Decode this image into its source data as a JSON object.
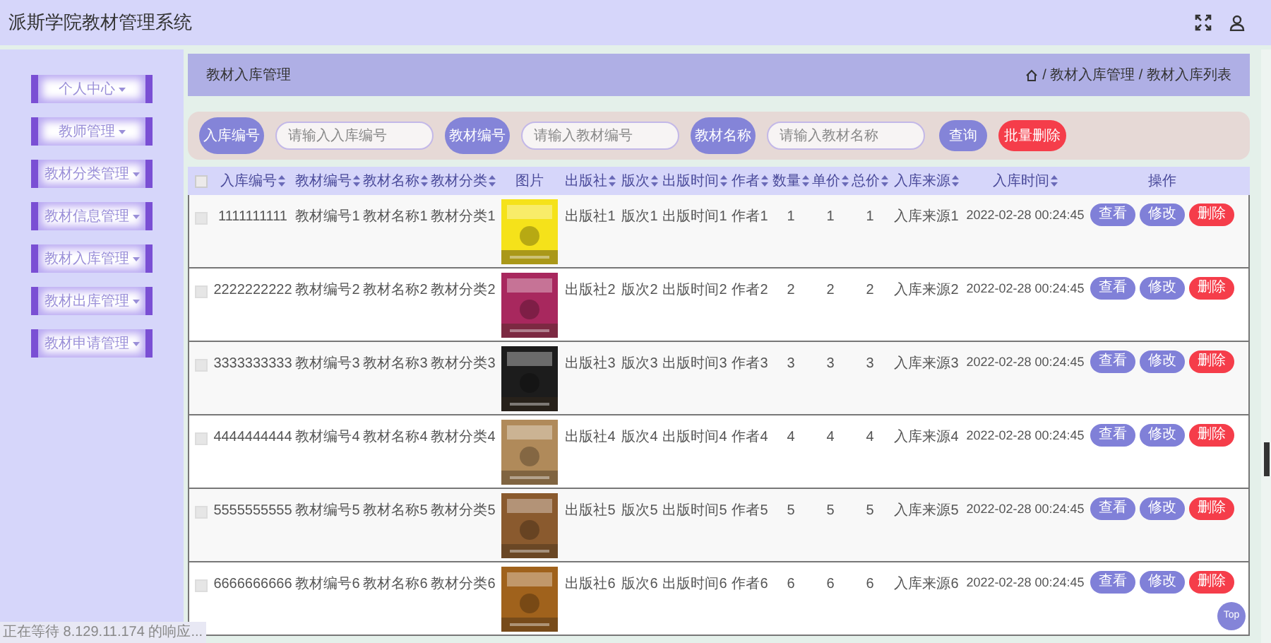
{
  "app_title": "派斯学院教材管理系统",
  "sidebar": {
    "items": [
      {
        "label": "个人中心"
      },
      {
        "label": "教师管理"
      },
      {
        "label": "教材分类管理"
      },
      {
        "label": "教材信息管理"
      },
      {
        "label": "教材入库管理"
      },
      {
        "label": "教材出库管理"
      },
      {
        "label": "教材申请管理"
      }
    ]
  },
  "page_header": {
    "title": "教材入库管理",
    "breadcrumb": "/ 教材入库管理 / 教材入库列表"
  },
  "search": {
    "fields": [
      {
        "label": "入库编号",
        "placeholder": "请输入入库编号"
      },
      {
        "label": "教材编号",
        "placeholder": "请输入教材编号"
      },
      {
        "label": "教材名称",
        "placeholder": "请输入教材名称"
      }
    ],
    "query_button": "查询",
    "batch_delete_button": "批量删除"
  },
  "table": {
    "columns": [
      {
        "label": "入库编号",
        "sortable": true
      },
      {
        "label": "教材编号",
        "sortable": true
      },
      {
        "label": "教材名称",
        "sortable": true
      },
      {
        "label": "教材分类",
        "sortable": true
      },
      {
        "label": "图片",
        "sortable": false
      },
      {
        "label": "出版社",
        "sortable": true
      },
      {
        "label": "版次",
        "sortable": true
      },
      {
        "label": "出版时间",
        "sortable": true
      },
      {
        "label": "作者",
        "sortable": true
      },
      {
        "label": "数量",
        "sortable": true
      },
      {
        "label": "单价",
        "sortable": true
      },
      {
        "label": "总价",
        "sortable": true
      },
      {
        "label": "入库来源",
        "sortable": true
      },
      {
        "label": "入库时间",
        "sortable": true
      },
      {
        "label": "操作",
        "sortable": false
      }
    ],
    "header_checked": false,
    "rows": [
      {
        "checked": false,
        "cells": [
          {
            "kind": "text",
            "text": "1111111111"
          },
          {
            "kind": "text",
            "text": "教材编号1"
          },
          {
            "kind": "text",
            "text": "教材名称1"
          },
          {
            "kind": "text",
            "text": "教材分类1"
          },
          {
            "kind": "picture",
            "color": "#f5e21a"
          },
          {
            "kind": "text",
            "text": "出版社1"
          },
          {
            "kind": "text",
            "text": "版次1"
          },
          {
            "kind": "text",
            "text": "出版时间1"
          },
          {
            "kind": "text",
            "text": "作者1"
          },
          {
            "kind": "text",
            "text": "1"
          },
          {
            "kind": "text",
            "text": "1"
          },
          {
            "kind": "text",
            "text": "1"
          },
          {
            "kind": "text",
            "text": "入库来源1"
          },
          {
            "kind": "text",
            "text": "2022-02-28 00:24:45"
          }
        ],
        "actions": [
          "查看",
          "修改",
          "删除"
        ]
      },
      {
        "checked": false,
        "cells": [
          {
            "kind": "text",
            "text": "2222222222"
          },
          {
            "kind": "text",
            "text": "教材编号2"
          },
          {
            "kind": "text",
            "text": "教材名称2"
          },
          {
            "kind": "text",
            "text": "教材分类2"
          },
          {
            "kind": "picture",
            "color": "#a8285e"
          },
          {
            "kind": "text",
            "text": "出版社2"
          },
          {
            "kind": "text",
            "text": "版次2"
          },
          {
            "kind": "text",
            "text": "出版时间2"
          },
          {
            "kind": "text",
            "text": "作者2"
          },
          {
            "kind": "text",
            "text": "2"
          },
          {
            "kind": "text",
            "text": "2"
          },
          {
            "kind": "text",
            "text": "2"
          },
          {
            "kind": "text",
            "text": "入库来源2"
          },
          {
            "kind": "text",
            "text": "2022-02-28 00:24:45"
          }
        ],
        "actions": [
          "查看",
          "修改",
          "删除"
        ]
      },
      {
        "checked": false,
        "cells": [
          {
            "kind": "text",
            "text": "3333333333"
          },
          {
            "kind": "text",
            "text": "教材编号3"
          },
          {
            "kind": "text",
            "text": "教材名称3"
          },
          {
            "kind": "text",
            "text": "教材分类3"
          },
          {
            "kind": "picture",
            "color": "#1c1c1c"
          },
          {
            "kind": "text",
            "text": "出版社3"
          },
          {
            "kind": "text",
            "text": "版次3"
          },
          {
            "kind": "text",
            "text": "出版时间3"
          },
          {
            "kind": "text",
            "text": "作者3"
          },
          {
            "kind": "text",
            "text": "3"
          },
          {
            "kind": "text",
            "text": "3"
          },
          {
            "kind": "text",
            "text": "3"
          },
          {
            "kind": "text",
            "text": "入库来源3"
          },
          {
            "kind": "text",
            "text": "2022-02-28 00:24:45"
          }
        ],
        "actions": [
          "查看",
          "修改",
          "删除"
        ]
      },
      {
        "checked": false,
        "cells": [
          {
            "kind": "text",
            "text": "4444444444"
          },
          {
            "kind": "text",
            "text": "教材编号4"
          },
          {
            "kind": "text",
            "text": "教材名称4"
          },
          {
            "kind": "text",
            "text": "教材分类4"
          },
          {
            "kind": "picture",
            "color": "#b08a5a"
          },
          {
            "kind": "text",
            "text": "出版社4"
          },
          {
            "kind": "text",
            "text": "版次4"
          },
          {
            "kind": "text",
            "text": "出版时间4"
          },
          {
            "kind": "text",
            "text": "作者4"
          },
          {
            "kind": "text",
            "text": "4"
          },
          {
            "kind": "text",
            "text": "4"
          },
          {
            "kind": "text",
            "text": "4"
          },
          {
            "kind": "text",
            "text": "入库来源4"
          },
          {
            "kind": "text",
            "text": "2022-02-28 00:24:45"
          }
        ],
        "actions": [
          "查看",
          "修改",
          "删除"
        ]
      },
      {
        "checked": false,
        "cells": [
          {
            "kind": "text",
            "text": "5555555555"
          },
          {
            "kind": "text",
            "text": "教材编号5"
          },
          {
            "kind": "text",
            "text": "教材名称5"
          },
          {
            "kind": "text",
            "text": "教材分类5"
          },
          {
            "kind": "picture",
            "color": "#8a5a2e"
          },
          {
            "kind": "text",
            "text": "出版社5"
          },
          {
            "kind": "text",
            "text": "版次5"
          },
          {
            "kind": "text",
            "text": "出版时间5"
          },
          {
            "kind": "text",
            "text": "作者5"
          },
          {
            "kind": "text",
            "text": "5"
          },
          {
            "kind": "text",
            "text": "5"
          },
          {
            "kind": "text",
            "text": "5"
          },
          {
            "kind": "text",
            "text": "入库来源5"
          },
          {
            "kind": "text",
            "text": "2022-02-28 00:24:45"
          }
        ],
        "actions": [
          "查看",
          "修改",
          "删除"
        ]
      },
      {
        "checked": false,
        "cells": [
          {
            "kind": "text",
            "text": "6666666666"
          },
          {
            "kind": "text",
            "text": "教材编号6"
          },
          {
            "kind": "text",
            "text": "教材名称6"
          },
          {
            "kind": "text",
            "text": "教材分类6"
          },
          {
            "kind": "picture",
            "color": "#a0621c"
          },
          {
            "kind": "text",
            "text": "出版社6"
          },
          {
            "kind": "text",
            "text": "版次6"
          },
          {
            "kind": "text",
            "text": "出版时间6"
          },
          {
            "kind": "text",
            "text": "作者6"
          },
          {
            "kind": "text",
            "text": "6"
          },
          {
            "kind": "text",
            "text": "6"
          },
          {
            "kind": "text",
            "text": "6"
          },
          {
            "kind": "text",
            "text": "入库来源6"
          },
          {
            "kind": "text",
            "text": "2022-02-28 00:24:45"
          }
        ],
        "actions": [
          "查看",
          "修改",
          "删除"
        ]
      }
    ]
  },
  "top_button": "Top",
  "status_bar": "正在等待 8.129.11.174 的响应..."
}
